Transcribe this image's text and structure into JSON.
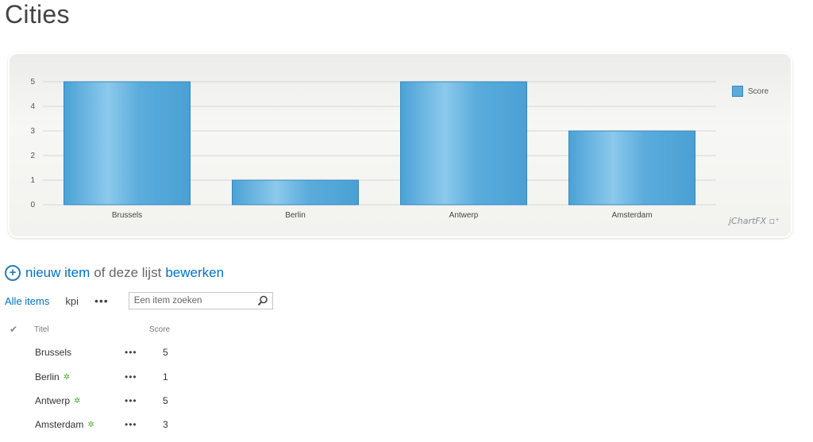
{
  "page": {
    "title": "Cities"
  },
  "chart": {
    "watermark": "jChartFX",
    "legend_label": "Score",
    "bar_color": "#5aacdc",
    "watermark_icon": "chart-logo-icon"
  },
  "chart_data": {
    "type": "bar",
    "categories": [
      "Brussels",
      "Berlin",
      "Antwerp",
      "Amsterdam"
    ],
    "series": [
      {
        "name": "Score",
        "values": [
          5,
          1,
          5,
          3
        ]
      }
    ],
    "yticks": [
      "0",
      "1",
      "2",
      "3",
      "4",
      "5"
    ],
    "ylim": [
      0,
      5
    ],
    "grid": true,
    "legend": "right",
    "title": "",
    "xlabel": "",
    "ylabel": ""
  },
  "toolbar": {
    "new_item": "nieuw item",
    "middle_text": "of deze lijst",
    "edit": "bewerken"
  },
  "views": {
    "all_items": "Alle items",
    "kpi": "kpi",
    "more": "•••"
  },
  "search": {
    "placeholder": "Een item zoeken"
  },
  "list": {
    "columns": {
      "title": "Titel",
      "score": "Score"
    },
    "rows": [
      {
        "title": "Brussels",
        "score": "5",
        "is_new": false
      },
      {
        "title": "Berlin",
        "score": "1",
        "is_new": true
      },
      {
        "title": "Antwerp",
        "score": "5",
        "is_new": true
      },
      {
        "title": "Amsterdam",
        "score": "3",
        "is_new": true
      }
    ],
    "dots": "•••",
    "new_marker": "✲"
  }
}
